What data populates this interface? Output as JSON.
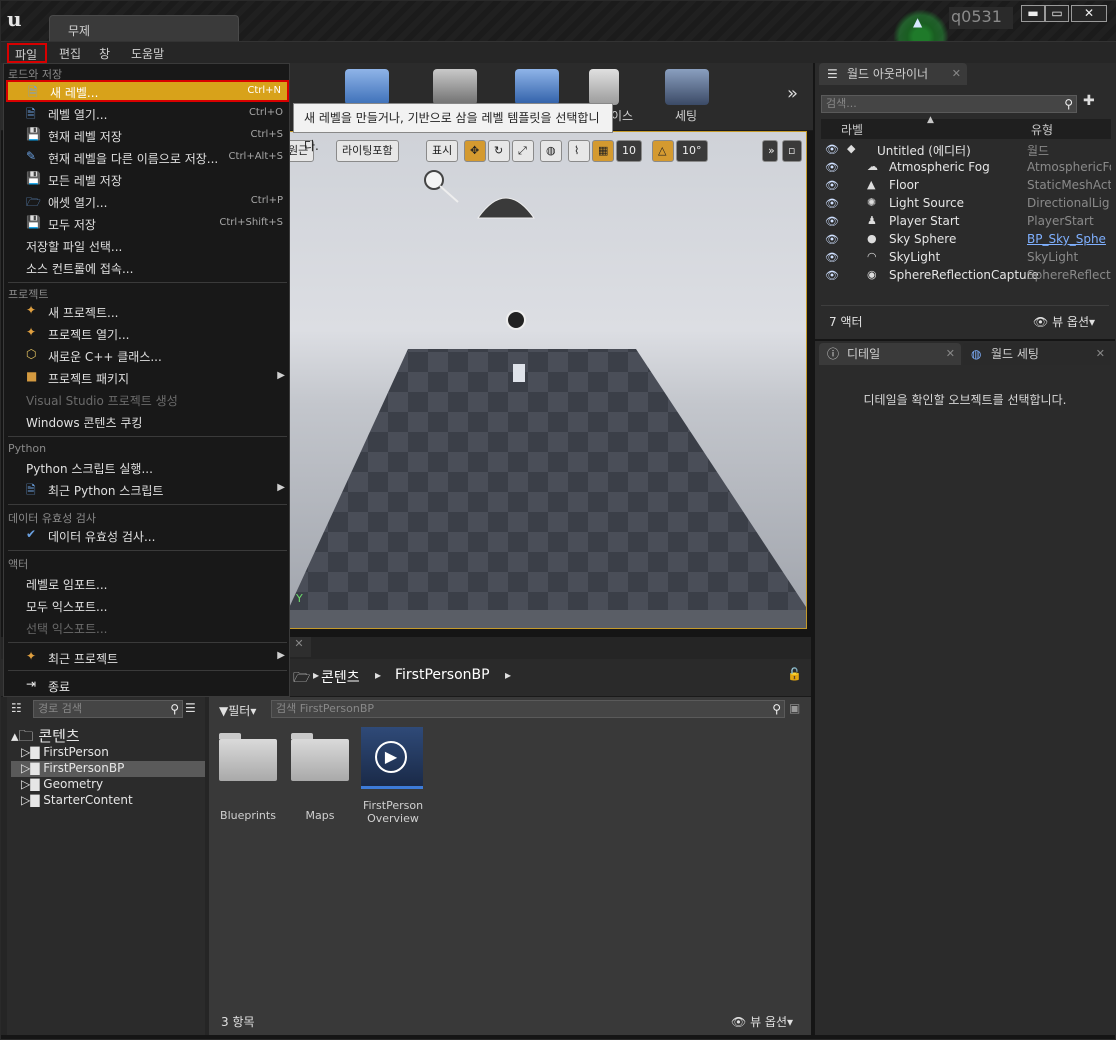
{
  "app": {
    "tab_title": "무제",
    "user": "q0531"
  },
  "menubar": {
    "file": "파일",
    "edit": "편집",
    "window": "창",
    "help": "도움말"
  },
  "toolbar": {
    "label_partial_1": "이스",
    "settings": "세팅"
  },
  "viewport": {
    "perspective": "원근",
    "lit": "라이팅포함",
    "show": "표시",
    "grid_snap": "10",
    "rot_snap": "10°",
    "axis_y": "Y"
  },
  "outliner": {
    "tab": "월드 아웃라이너",
    "search_placeholder": "검색...",
    "col_label": "라벨",
    "col_type": "유형",
    "rows": [
      {
        "name": "Untitled (에디터)",
        "type": "월드"
      },
      {
        "name": "Atmospheric Fog",
        "type": "AtmosphericFo"
      },
      {
        "name": "Floor",
        "type": "StaticMeshAct"
      },
      {
        "name": "Light Source",
        "type": "DirectionalLig"
      },
      {
        "name": "Player Start",
        "type": "PlayerStart"
      },
      {
        "name": "Sky Sphere",
        "type": "BP_Sky_Sphe"
      },
      {
        "name": "SkyLight",
        "type": "SkyLight"
      },
      {
        "name": "SphereReflectionCapture",
        "type": "SphereReflecti"
      }
    ],
    "count": "7 액터",
    "view_options": "뷰 옵션"
  },
  "details": {
    "tab": "디테일",
    "world_tab": "월드 세팅",
    "empty_msg": "디테일을 확인할 오브젝트를 선택합니다."
  },
  "content_browser": {
    "path_root": "콘텐츠",
    "path_current": "FirstPersonBP",
    "path_search_placeholder": "경로 검색",
    "filter": "필터",
    "asset_search_placeholder": "검색 FirstPersonBP",
    "tree_root": "콘텐츠",
    "tree": [
      "FirstPerson",
      "FirstPersonBP",
      "Geometry",
      "StarterContent"
    ],
    "assets": [
      {
        "label": "Blueprints"
      },
      {
        "label": "Maps"
      },
      {
        "label": "FirstPerson Overview"
      }
    ],
    "count": "3 항목",
    "view_options": "뷰 옵션"
  },
  "file_menu": {
    "sec_load_save": "로드와 저장",
    "new_level": "새 레벨...",
    "new_level_sc": "Ctrl+N",
    "open_level": "레벨 열기...",
    "open_level_sc": "Ctrl+O",
    "save_current": "현재 레벨 저장",
    "save_current_sc": "Ctrl+S",
    "save_as": "현재 레벨을 다른 이름으로 저장...",
    "save_as_sc": "Ctrl+Alt+S",
    "save_all_levels": "모든 레벨 저장",
    "open_asset": "애셋 열기...",
    "open_asset_sc": "Ctrl+P",
    "save_all": "모두 저장",
    "save_all_sc": "Ctrl+Shift+S",
    "choose_files": "저장할 파일 선택...",
    "source_control": "소스 컨트롤에 접속...",
    "sec_project": "프로젝트",
    "new_project": "새 프로젝트...",
    "open_project": "프로젝트 열기...",
    "new_cpp": "새로운 C++ 클래스...",
    "package_project": "프로젝트 패키지",
    "vs_project": "Visual Studio 프로젝트 생성",
    "cook_windows": "Windows 콘텐츠 쿠킹",
    "sec_python": "Python",
    "run_python": "Python 스크립트 실행...",
    "recent_python": "최근 Python 스크립트",
    "sec_data_validation": "데이터 유효성 검사",
    "validate_data": "데이터 유효성 검사...",
    "sec_actor": "액터",
    "import_level": "레벨로 임포트...",
    "export_all": "모두 익스포트...",
    "export_selected": "선택 익스포트...",
    "recent_projects": "최근 프로젝트",
    "exit": "종료"
  },
  "tooltip": {
    "text": "새 레벨을 만들거나, 기반으로 삼을 레벨 템플릿을 선택합니다."
  },
  "colors": {
    "highlight": "#d8a21a",
    "focus_border": "#d80000",
    "viewport_border": "#c49a2a"
  }
}
